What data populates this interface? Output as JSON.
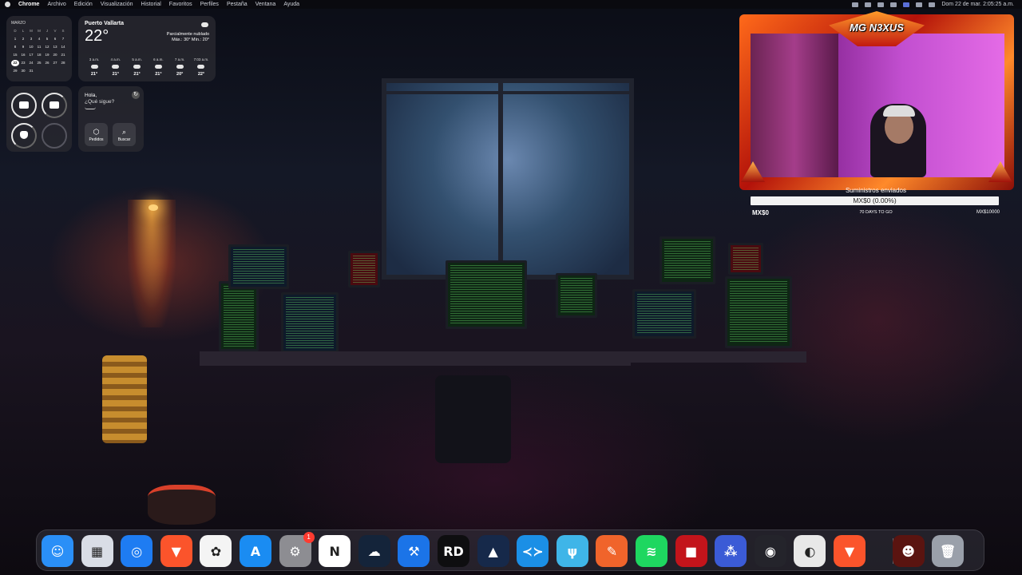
{
  "menubar": {
    "app": "Chrome",
    "items": [
      "Archivo",
      "Edición",
      "Visualización",
      "Historial",
      "Favoritos",
      "Perfiles",
      "Pestaña",
      "Ventana",
      "Ayuda"
    ],
    "clock": "Dom 22 de mar.  2:05:25 a.m."
  },
  "calendar": {
    "month": "MARZO",
    "days_of_week": [
      "D",
      "L",
      "M",
      "M",
      "J",
      "V",
      "S"
    ],
    "weeks": [
      [
        "1",
        "2",
        "3",
        "4",
        "5",
        "6",
        "7"
      ],
      [
        "8",
        "9",
        "10",
        "11",
        "12",
        "13",
        "14"
      ],
      [
        "15",
        "16",
        "17",
        "18",
        "19",
        "20",
        "21"
      ],
      [
        "22",
        "23",
        "24",
        "25",
        "26",
        "27",
        "28"
      ],
      [
        "29",
        "30",
        "31",
        "",
        "",
        "",
        ""
      ]
    ],
    "today": "22"
  },
  "weather": {
    "city": "Puerto Vallarta",
    "temp": "22°",
    "condition": "Parcialmente nublado",
    "hilo": "Máx.: 30° Mín.: 20°",
    "hours": [
      {
        "time": "3 a.m.",
        "temp": "21°"
      },
      {
        "time": "4 a.m.",
        "temp": "21°"
      },
      {
        "time": "5 a.m.",
        "temp": "21°"
      },
      {
        "time": "6 a.m.",
        "temp": "21°"
      },
      {
        "time": "7 a.m.",
        "temp": "20°"
      },
      {
        "time": "7:03 a.m.",
        "temp": "22°"
      }
    ]
  },
  "siri": {
    "greeting": "Hola,",
    "question": "¿Qué sigue?",
    "buttons": [
      {
        "icon": "box-icon",
        "label": "Pedidos"
      },
      {
        "icon": "search-icon",
        "label": "Buscar"
      }
    ]
  },
  "devices": {
    "laptop_level": 1.0,
    "case_level": 0.75,
    "airpods_level": 0.75
  },
  "overlay": {
    "logo": "MG N3XUS",
    "goal_title": "Suministros enviados",
    "goal_value": "MX$0 (0.00%)",
    "goal_progress": 0.0,
    "goal_start": "MX$0",
    "goal_days": "70 DAYS TO GO",
    "goal_end": "MX$10000"
  },
  "dock": {
    "apps": [
      {
        "name": "finder-icon",
        "glyph": "☺",
        "color": "#2a8ff7"
      },
      {
        "name": "launchpad-icon",
        "glyph": "▦",
        "color": "#d9dde6"
      },
      {
        "name": "safari-icon",
        "glyph": "◎",
        "color": "#1e7cf2"
      },
      {
        "name": "brave-icon",
        "glyph": "▼",
        "color": "#fb542b"
      },
      {
        "name": "photos-icon",
        "glyph": "✿",
        "color": "#f4f4f4"
      },
      {
        "name": "app-store-icon",
        "glyph": "A",
        "color": "#1a8cf2"
      },
      {
        "name": "system-settings-icon",
        "glyph": "⚙",
        "color": "#8d8d92",
        "badge": "1"
      },
      {
        "name": "notion-icon",
        "glyph": "N",
        "color": "#ffffff"
      },
      {
        "name": "cloud-app-icon",
        "glyph": "☁",
        "color": "#14243a"
      },
      {
        "name": "xcode-icon",
        "glyph": "⚒",
        "color": "#1b74e8"
      },
      {
        "name": "rider-icon",
        "glyph": "RD",
        "color": "#0e0e10"
      },
      {
        "name": "arc-icon",
        "glyph": "▲",
        "color": "#16294a"
      },
      {
        "name": "vscode-icon",
        "glyph": "≺≻",
        "color": "#1b8fe6"
      },
      {
        "name": "fork-icon",
        "glyph": "ψ",
        "color": "#3fb5e8"
      },
      {
        "name": "pen-tool-icon",
        "glyph": "✎",
        "color": "#f0642b"
      },
      {
        "name": "spotify-icon",
        "glyph": "≋",
        "color": "#1ed760"
      },
      {
        "name": "red-app-icon",
        "glyph": "■",
        "color": "#c3141b"
      },
      {
        "name": "molecule-icon",
        "glyph": "⁂",
        "color": "#3b5bd6"
      },
      {
        "name": "obs-icon",
        "glyph": "◉",
        "color": "#24242b"
      },
      {
        "name": "chrome-icon",
        "glyph": "◐",
        "color": "#e8e8e8"
      },
      {
        "name": "brave-2-icon",
        "glyph": "▼",
        "color": "#fb542b"
      },
      {
        "name": "avatar-icon",
        "glyph": "☻",
        "color": "#5a1410"
      },
      {
        "name": "trash-icon",
        "glyph": "🗑",
        "color": "#9aa0aa"
      }
    ]
  }
}
